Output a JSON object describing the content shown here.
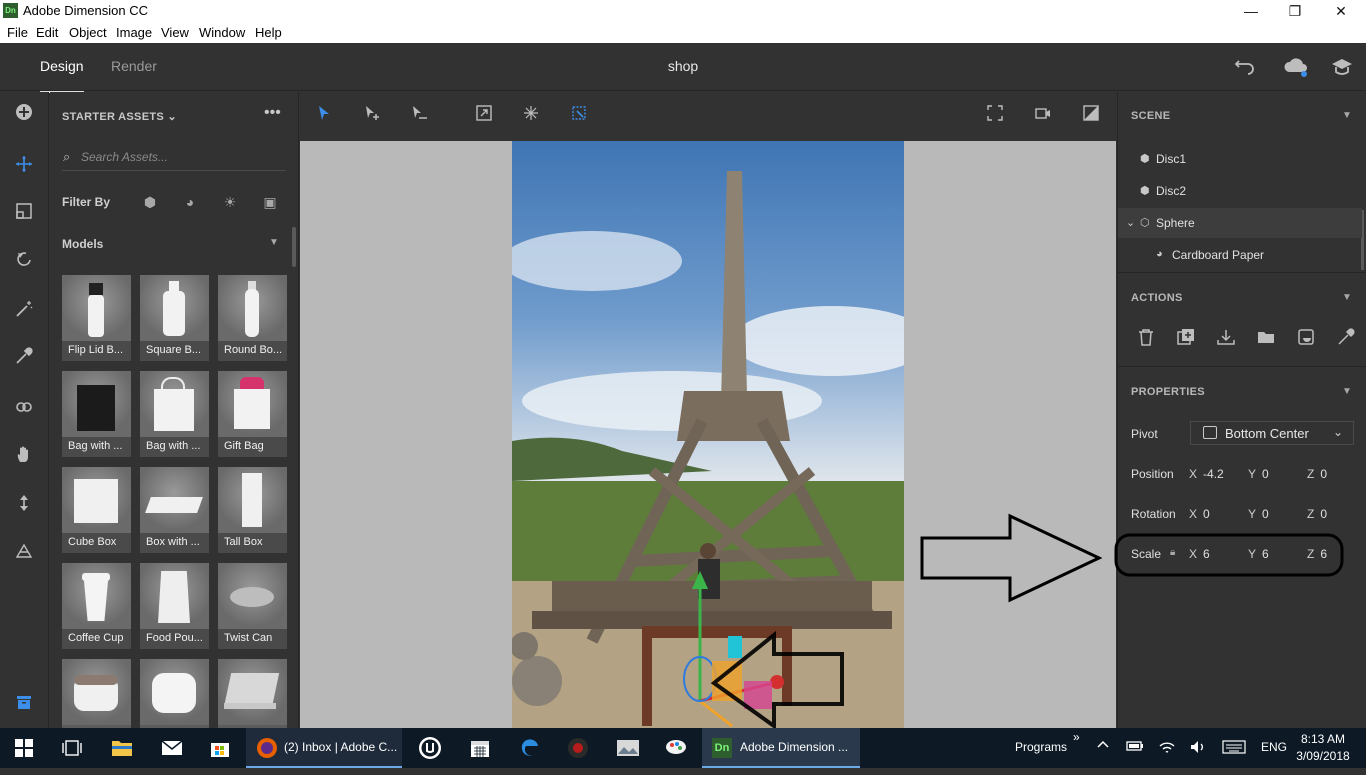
{
  "window": {
    "app_icon": "Dn",
    "title": "Adobe Dimension CC",
    "controls": {
      "minimize": "—",
      "restore": "❐",
      "close": "✕"
    }
  },
  "menubar": [
    "File",
    "Edit",
    "Object",
    "Image",
    "View",
    "Window",
    "Help"
  ],
  "header": {
    "tabs": [
      {
        "label": "Design",
        "active": true
      },
      {
        "label": "Render",
        "active": false
      }
    ],
    "document_title": "shop",
    "icons": [
      "undo-icon",
      "cloud-icon",
      "learn-icon"
    ]
  },
  "left_tools": [
    "add-icon",
    "select-icon",
    "frame-icon",
    "orbit-icon",
    "magic-wand-icon",
    "eyedropper-icon",
    "sample-icon",
    "pan-icon",
    "dolly-icon",
    "camera-bookmark-icon",
    "library-icon"
  ],
  "assets": {
    "header": "STARTER ASSETS",
    "more": "•••",
    "search_placeholder": "Search Assets...",
    "filter_label": "Filter By",
    "filter_icons": [
      "models-filter-icon",
      "materials-filter-icon",
      "lights-filter-icon",
      "images-filter-icon"
    ],
    "section": "Models",
    "models": [
      {
        "label": "Flip Lid B..."
      },
      {
        "label": "Square B..."
      },
      {
        "label": "Round Bo..."
      },
      {
        "label": "Bag with ..."
      },
      {
        "label": "Bag with ..."
      },
      {
        "label": "Gift Bag"
      },
      {
        "label": "Cube Box"
      },
      {
        "label": "Box with ..."
      },
      {
        "label": "Tall Box"
      },
      {
        "label": "Coffee Cup"
      },
      {
        "label": "Food Pou..."
      },
      {
        "label": "Twist Can"
      },
      {
        "label": ""
      },
      {
        "label": ""
      },
      {
        "label": ""
      }
    ]
  },
  "toolbar": {
    "left_tools": [
      "select-tool-icon",
      "magic-select-icon",
      "ground-select-icon",
      "fit-icon",
      "snap-icon",
      "transform-box-icon"
    ],
    "right_tools": [
      "fullscreen-icon",
      "camera-view-icon",
      "quality-icon"
    ]
  },
  "scene": {
    "header": "SCENE",
    "items": [
      {
        "label": "Disc1",
        "selected": false,
        "indent": 1
      },
      {
        "label": "Disc2",
        "selected": false,
        "indent": 1
      },
      {
        "label": "Sphere",
        "selected": true,
        "indent": 0
      },
      {
        "label": "Cardboard Paper",
        "selected": false,
        "indent": 2
      }
    ]
  },
  "actions": {
    "header": "ACTIONS",
    "icons": [
      "delete-icon",
      "duplicate-icon",
      "import-icon",
      "group-icon",
      "hide-icon",
      "eyedropper-action-icon"
    ]
  },
  "properties": {
    "header": "PROPERTIES",
    "pivot": {
      "label": "Pivot",
      "value": "Bottom Center"
    },
    "position": {
      "label": "Position",
      "x": "-4.2",
      "y": "0",
      "z": "0"
    },
    "rotation": {
      "label": "Rotation",
      "x": "0",
      "y": "0",
      "z": "0"
    },
    "scale": {
      "label": "Scale",
      "x": "6",
      "y": "6",
      "z": "6"
    },
    "axis_labels": {
      "x": "X",
      "y": "Y",
      "z": "Z"
    }
  },
  "taskbar": {
    "apps": [
      {
        "name": "start-icon"
      },
      {
        "name": "task-view-icon"
      },
      {
        "name": "file-explorer-icon"
      },
      {
        "name": "mail-icon"
      },
      {
        "name": "store-icon"
      },
      {
        "name": "firefox-icon",
        "label": "(2) Inbox | Adobe C..."
      },
      {
        "name": "unreal-icon"
      },
      {
        "name": "calendar-icon"
      },
      {
        "name": "edge-icon"
      },
      {
        "name": "app-red-icon"
      },
      {
        "name": "app-photo-icon"
      },
      {
        "name": "paint-icon"
      },
      {
        "name": "dimension-icon",
        "label": "Adobe Dimension ..."
      }
    ],
    "dimension_badge": "Dn",
    "programs_label": "Programs",
    "programs_chev": "»",
    "language": "ENG",
    "time": "8:13 AM",
    "date": "3/09/2018"
  },
  "colors": {
    "panel_bg": "#323232",
    "accent": "#3c8ee8",
    "canvas_bg": "#b9b9b9",
    "taskbar_bg": "#0d1a26"
  }
}
